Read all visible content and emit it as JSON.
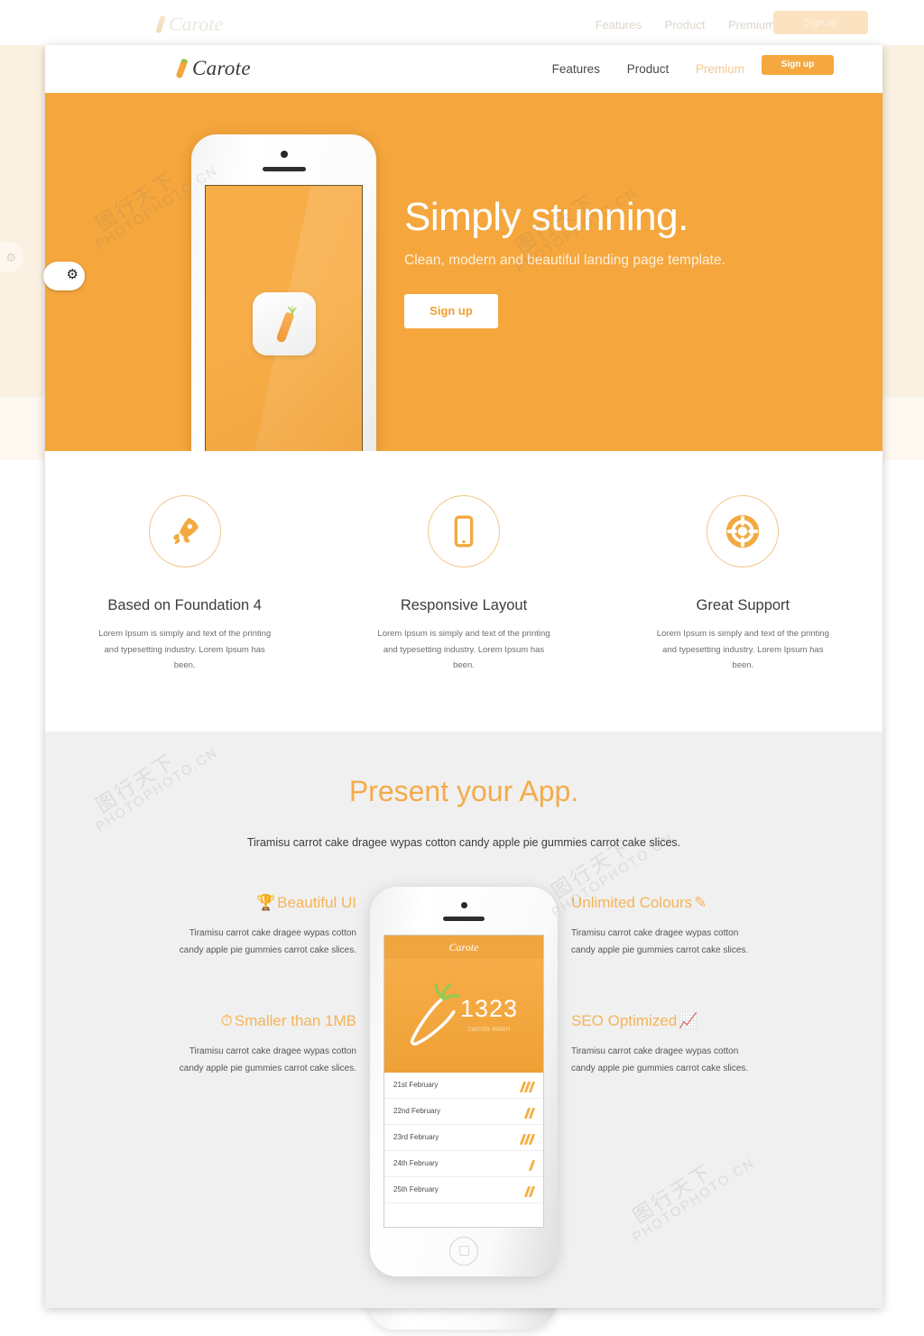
{
  "background_page": {
    "logo": "Carote",
    "nav_links": [
      "Features",
      "Product",
      "Premium"
    ],
    "signup_label": "Sign up"
  },
  "nav": {
    "logo": "Carote",
    "links": [
      {
        "label": "Features",
        "state": "normal"
      },
      {
        "label": "Product",
        "state": "normal"
      },
      {
        "label": "Premium",
        "state": "muted"
      }
    ],
    "signup_label": "Sign up"
  },
  "hero": {
    "title": "Simply stunning.",
    "subtitle": "Clean, modern and beautiful landing page template.",
    "cta_label": "Sign up"
  },
  "features": [
    {
      "icon": "rocket-icon",
      "title": "Based on Foundation 4",
      "text": "Lorem Ipsum is simply and text of the printing and typesetting industry. Lorem Ipsum has been."
    },
    {
      "icon": "mobile-icon",
      "title": "Responsive Layout",
      "text": "Lorem Ipsum is simply and text of the printing and typesetting industry. Lorem Ipsum has been."
    },
    {
      "icon": "lifebuoy-icon",
      "title": "Great Support",
      "text": "Lorem Ipsum is simply and text of the printing and typesetting industry. Lorem Ipsum has been."
    }
  ],
  "present": {
    "title": "Present your App.",
    "subtitle": "Tiramisu carrot cake dragee wypas cotton candy apple pie gummies carrot cake slices.",
    "left_items": [
      {
        "icon": "trophy-icon",
        "title": "Beautiful UI",
        "text": "Tiramisu carrot cake dragee wypas cotton candy apple pie gummies carrot cake slices."
      },
      {
        "icon": "speedometer-icon",
        "title": "Smaller than 1MB",
        "text": "Tiramisu carrot cake dragee wypas cotton candy apple pie gummies carrot cake slices."
      }
    ],
    "right_items": [
      {
        "icon": "pencil-icon",
        "title": "Unlimited Colours",
        "text": "Tiramisu carrot cake dragee wypas cotton candy apple pie gummies carrot cake slices."
      },
      {
        "icon": "bar-chart-icon",
        "title": "SEO Optimized",
        "text": "Tiramisu carrot cake dragee wypas cotton candy apple pie gummies carrot cake slices."
      }
    ],
    "phone_app": {
      "status_title": "Carote",
      "count": "1323",
      "count_label": "carrots eaten",
      "rows": [
        {
          "date": "21st February",
          "marks": 3
        },
        {
          "date": "22nd February",
          "marks": 2
        },
        {
          "date": "23rd February",
          "marks": 3
        },
        {
          "date": "24th February",
          "marks": 1
        },
        {
          "date": "25th February",
          "marks": 2
        }
      ]
    }
  },
  "watermark": {
    "cn": "图行天下",
    "domain": "PHOTOPHOTO.CN"
  },
  "colors": {
    "accent": "#f5a63c",
    "accent_dark": "#ef9c2c",
    "accent_light": "#f5b456",
    "muted_link": "#f6c98c",
    "section_grey": "#f0f0f0",
    "text_dark": "#3c3c3c"
  }
}
